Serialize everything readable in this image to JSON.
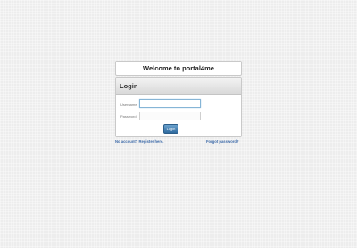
{
  "welcome": {
    "title": "Welcome to portal4me"
  },
  "login_panel": {
    "heading": "Login",
    "username_label": "Username",
    "username_value": "",
    "password_label": "Password",
    "password_value": "",
    "submit_label": "Login"
  },
  "links": {
    "register": "No account? Register here.",
    "forgot": "Forgot password?"
  },
  "colors": {
    "accent": "#3d6aa8",
    "button": "#2f6ba0",
    "background": "#ededed"
  }
}
